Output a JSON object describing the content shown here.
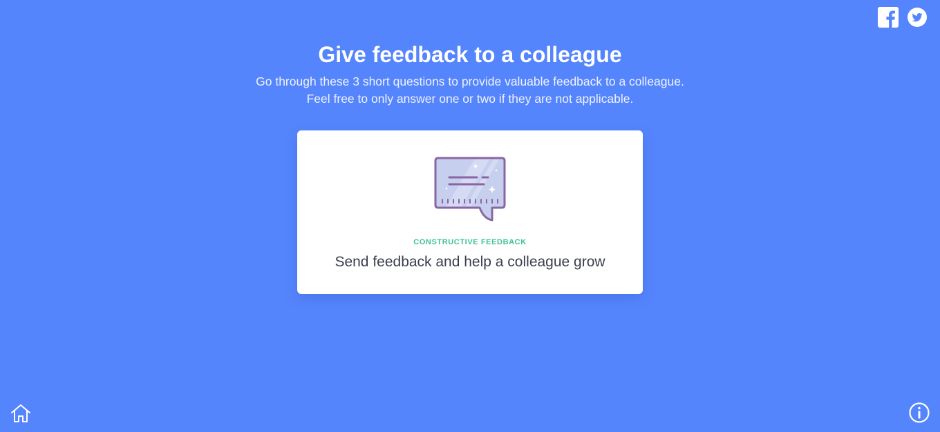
{
  "header": {
    "title": "Give feedback to a colleague",
    "subtitle_line1": "Go through these 3 short questions to provide valuable feedback to a colleague.",
    "subtitle_line2": "Feel free to only answer one or two if they are not applicable."
  },
  "social": {
    "icons": [
      "facebook-icon",
      "twitter-icon"
    ]
  },
  "card": {
    "tag": "CONSTRUCTIVE FEEDBACK",
    "text": "Send feedback and help a colleague grow",
    "icon": "speech-bubble-icon"
  },
  "footer": {
    "left_icon": "home-icon",
    "right_icon": "info-icon"
  },
  "colors": {
    "background": "#5585fd",
    "card_background": "#ffffff",
    "tag_color": "#3cc29a",
    "text_color": "#3a3f4d",
    "icon_stroke": "#8a65a3",
    "icon_fill": "#c7cfee"
  }
}
